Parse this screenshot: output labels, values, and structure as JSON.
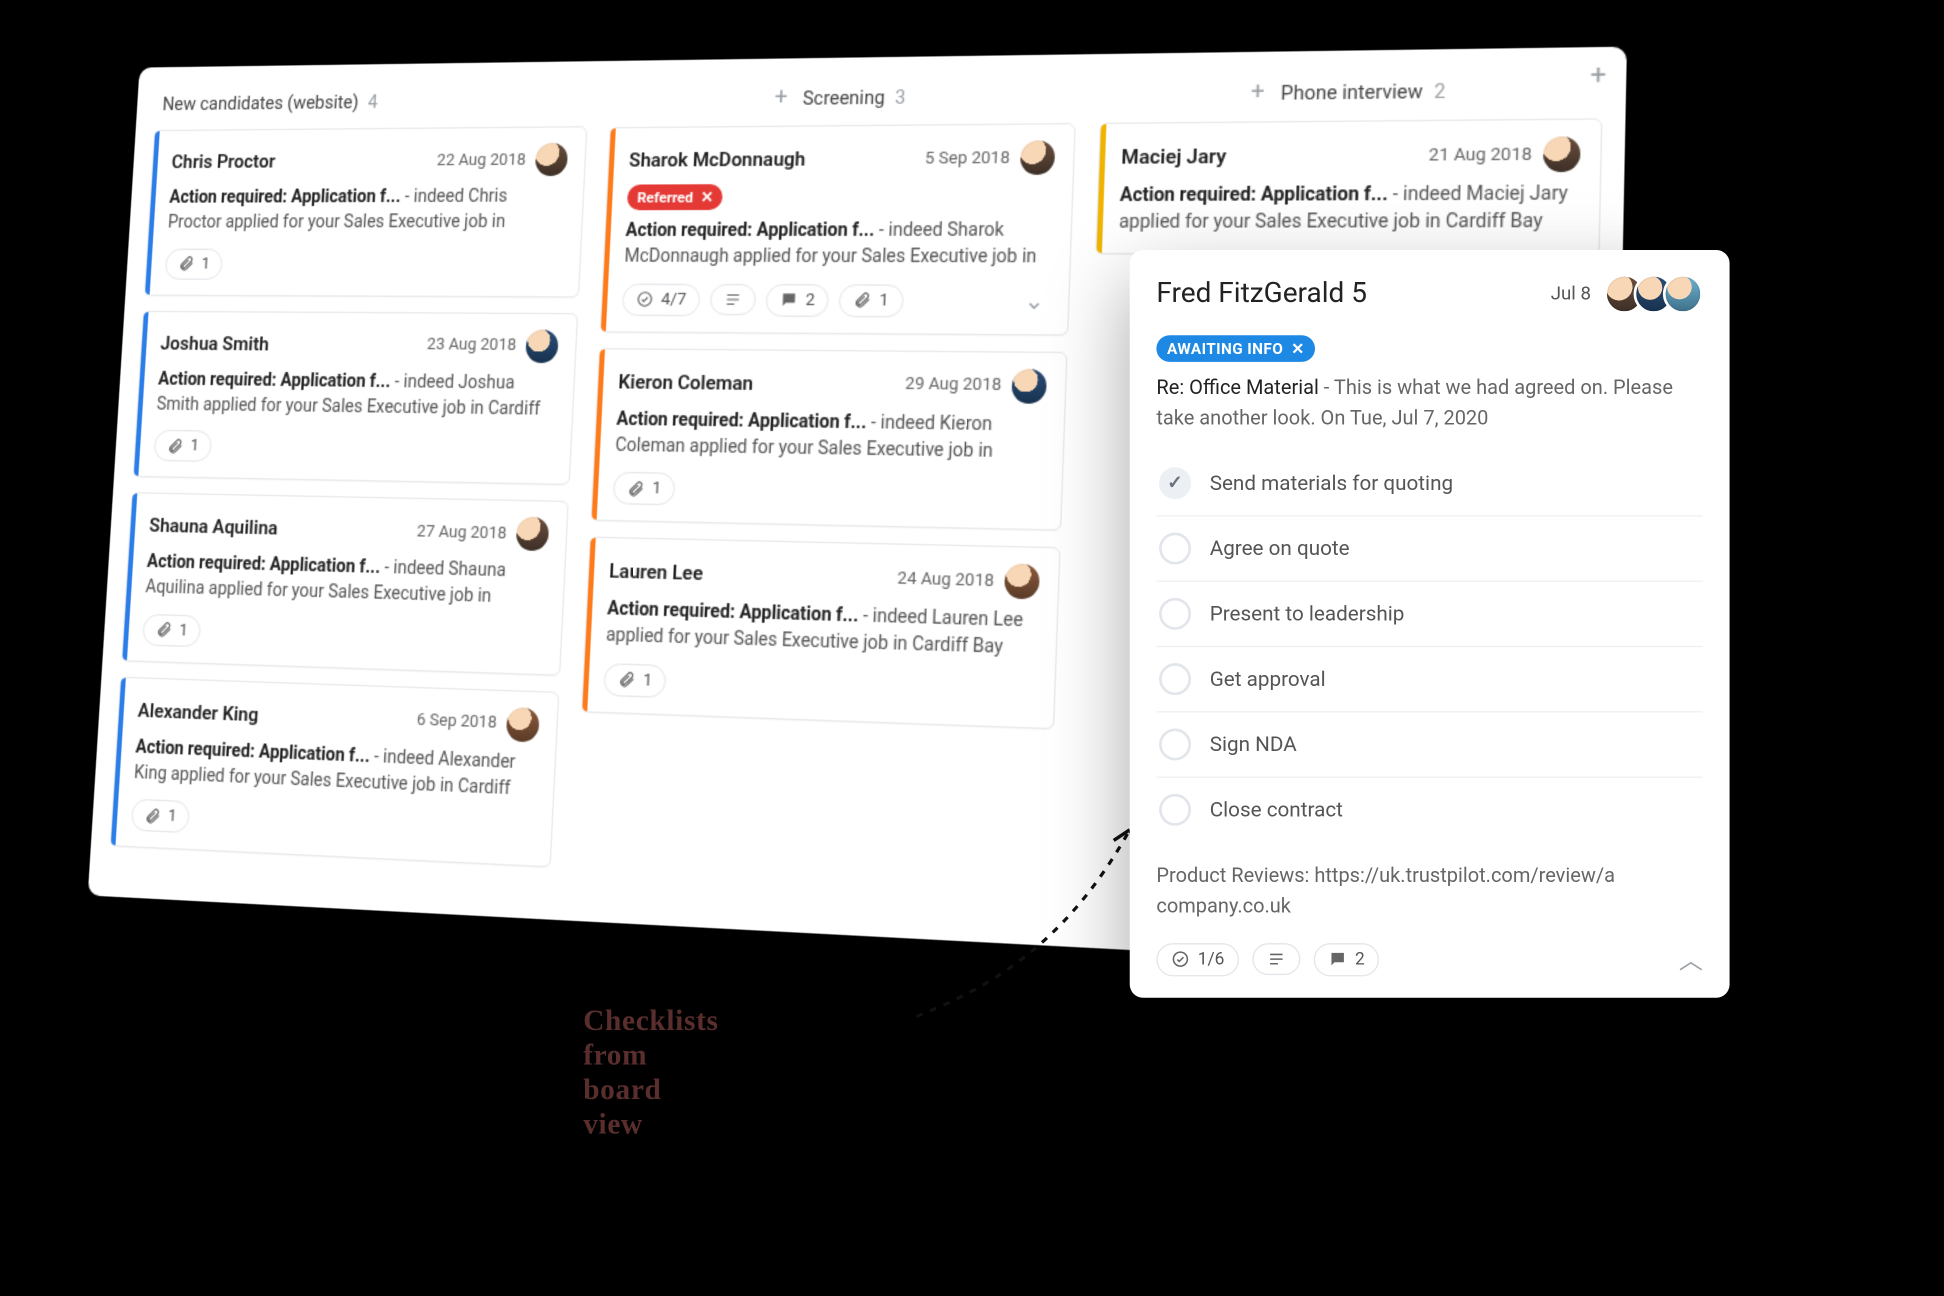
{
  "annotation": {
    "text": "Checklists from board view"
  },
  "board": {
    "corner_plus": "+",
    "columns": [
      {
        "title": "New candidates (website)",
        "count": "4",
        "stripe": "blue",
        "align": "left",
        "show_plus": false,
        "cards": [
          {
            "name": "Chris Proctor",
            "date": "22 Aug 2018",
            "avatar": "a",
            "tag": null,
            "lead": "Action required: Application f...",
            "rest": " - indeed Chris Proctor applied for your Sales Executive job in",
            "pills": [
              {
                "kind": "attach",
                "text": "1"
              }
            ],
            "chevron": false
          },
          {
            "name": "Joshua Smith",
            "date": "23 Aug 2018",
            "avatar": "b",
            "tag": null,
            "lead": "Action required: Application f...",
            "rest": " - indeed Joshua Smith applied for your Sales Executive job in Cardiff",
            "pills": [
              {
                "kind": "attach",
                "text": "1"
              }
            ],
            "chevron": false
          },
          {
            "name": "Shauna Aquilina",
            "date": "27 Aug 2018",
            "avatar": "a",
            "tag": null,
            "lead": "Action required: Application f...",
            "rest": " - indeed Shauna Aquilina applied for your Sales Executive job in",
            "pills": [
              {
                "kind": "attach",
                "text": "1"
              }
            ],
            "chevron": false
          },
          {
            "name": "Alexander King",
            "date": "6 Sep 2018",
            "avatar": "c",
            "tag": null,
            "lead": "Action required: Application f...",
            "rest": " - indeed Alexander King applied for your Sales Executive job in Cardiff",
            "pills": [
              {
                "kind": "attach",
                "text": "1"
              }
            ],
            "chevron": false
          }
        ]
      },
      {
        "title": "Screening",
        "count": "3",
        "stripe": "orange",
        "align": "center",
        "show_plus": true,
        "cards": [
          {
            "name": "Sharok McDonnaugh",
            "date": "5 Sep 2018",
            "avatar": "a",
            "tag": {
              "text": "Referred",
              "style": "red"
            },
            "lead": "Action required: Application f...",
            "rest": " - indeed Sharok McDonnaugh applied for your Sales Executive job in",
            "pills": [
              {
                "kind": "progress",
                "text": "4/7"
              },
              {
                "kind": "notes",
                "text": ""
              },
              {
                "kind": "comments",
                "text": "2"
              },
              {
                "kind": "attach",
                "text": "1"
              }
            ],
            "chevron": true
          },
          {
            "name": "Kieron Coleman",
            "date": "29 Aug 2018",
            "avatar": "b",
            "tag": null,
            "lead": "Action required: Application f...",
            "rest": " - indeed Kieron Coleman applied for your Sales Executive job in",
            "pills": [
              {
                "kind": "attach",
                "text": "1"
              }
            ],
            "chevron": false
          },
          {
            "name": "Lauren Lee",
            "date": "24 Aug 2018",
            "avatar": "c",
            "tag": null,
            "lead": "Action required: Application f...",
            "rest": " - indeed Lauren Lee applied for your Sales Executive job in Cardiff Bay",
            "pills": [
              {
                "kind": "attach",
                "text": "1"
              }
            ],
            "chevron": false
          }
        ]
      },
      {
        "title": "Phone interview",
        "count": "2",
        "stripe": "gold",
        "align": "center",
        "show_plus": true,
        "cards": [
          {
            "name": "Maciej Jary",
            "date": "21 Aug 2018",
            "avatar": "a",
            "tag": null,
            "lead": "Action required: Application f...",
            "rest": " - indeed Maciej Jary applied for your Sales Executive job in Cardiff Bay",
            "pills": [],
            "chevron": false
          }
        ]
      }
    ]
  },
  "detail": {
    "title": "Fred FitzGerald 5",
    "date": "Jul 8",
    "tag": {
      "text": "AWAITING INFO",
      "close_label": "✕"
    },
    "subject": "Re: Office Material",
    "preview": " - This is what we had agreed on. Please take another look. On Tue, Jul 7, 2020",
    "checklist": [
      {
        "label": "Send materials for quoting",
        "done": true
      },
      {
        "label": "Agree on quote",
        "done": false
      },
      {
        "label": "Present to leadership",
        "done": false
      },
      {
        "label": "Get approval",
        "done": false
      },
      {
        "label": "Sign NDA",
        "done": false
      },
      {
        "label": "Close contract",
        "done": false
      }
    ],
    "note": "Product Reviews: https://uk.trustpilot.com/review/a\ncompany.co.uk",
    "footer": {
      "progress": "1/6",
      "comments": "2"
    }
  },
  "icons": {
    "attach": "attach-icon",
    "comments": "comment-icon",
    "notes": "notes-icon",
    "progress": "progress-icon"
  }
}
